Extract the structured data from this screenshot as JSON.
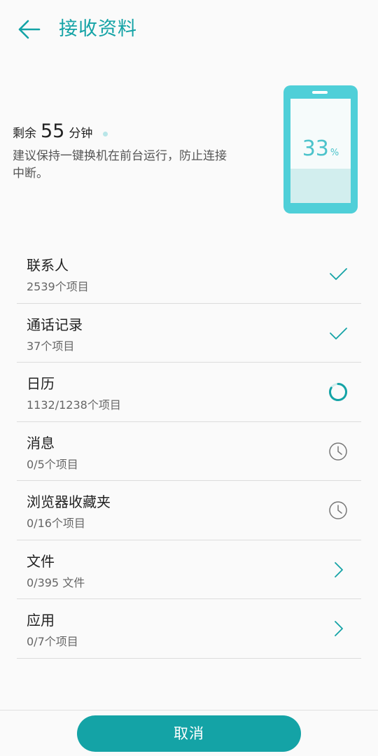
{
  "header": {
    "title": "接收资料"
  },
  "status": {
    "remaining_prefix": "剩余",
    "remaining_value": "55",
    "remaining_unit": "分钟",
    "advice": "建议保持一键换机在前台运行，防止连接中断。",
    "progress_value": "33",
    "progress_unit": "%",
    "progress_fraction": 0.33
  },
  "items": [
    {
      "name": "联系人",
      "detail": "2539个项目",
      "state": "done"
    },
    {
      "name": "通话记录",
      "detail": "37个项目",
      "state": "done"
    },
    {
      "name": "日历",
      "detail": "1132/1238个项目",
      "state": "in-progress"
    },
    {
      "name": "消息",
      "detail": "0/5个项目",
      "state": "pending"
    },
    {
      "name": "浏览器收藏夹",
      "detail": "0/16个项目",
      "state": "pending"
    },
    {
      "name": "文件",
      "detail": "0/395 文件",
      "state": "expandable"
    },
    {
      "name": "应用",
      "detail": "0/7个项目",
      "state": "expandable"
    }
  ],
  "footer": {
    "cancel_label": "取消"
  },
  "colors": {
    "accent": "#14a3a6",
    "phone": "#4fcfd8"
  }
}
